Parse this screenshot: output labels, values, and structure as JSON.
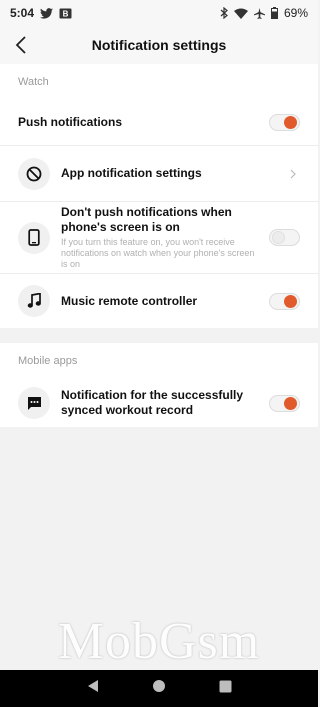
{
  "status_bar": {
    "time": "5:04",
    "battery": "69%",
    "icons": [
      "twitter-icon",
      "mail-icon",
      "bluetooth-icon",
      "wifi-icon",
      "airplane-icon",
      "battery-icon"
    ]
  },
  "header": {
    "title": "Notification settings",
    "back_icon": "chevron-left-icon"
  },
  "watch_section": {
    "label": "Watch",
    "push": {
      "title": "Push notifications",
      "enabled": true
    },
    "app_settings": {
      "title": "App notification settings",
      "icon": "block-icon"
    },
    "screen_on": {
      "title": "Don't push notifications when phone's screen is on",
      "subtitle": "If you turn this feature on, you won't receive notifications on watch when your phone's screen is on",
      "icon": "phone-icon",
      "enabled": false
    },
    "music": {
      "title": "Music remote controller",
      "icon": "music-note-icon",
      "enabled": true
    }
  },
  "mobile_section": {
    "label": "Mobile apps",
    "workout": {
      "title": "Notification for the successfully synced workout record",
      "icon": "message-icon",
      "enabled": true
    }
  },
  "watermark": "MobGsm",
  "colors": {
    "accent": "#e05a2b",
    "background": "#f2f2f2",
    "nav": "#000000"
  }
}
